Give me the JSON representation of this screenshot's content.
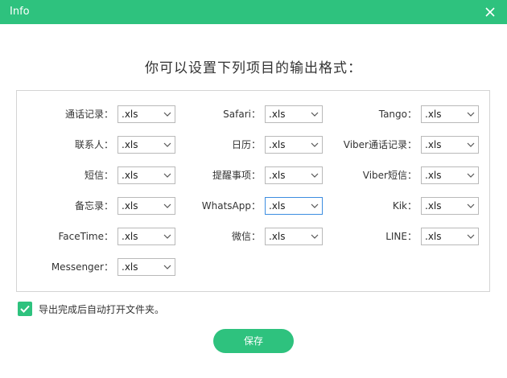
{
  "window": {
    "title": "Info",
    "accent_color": "#2ec27e",
    "close_icon": "close-icon"
  },
  "heading": "你可以设置下列项目的输出格式：",
  "formats": {
    "col1": [
      {
        "label": "通话记录：",
        "value": ".xls"
      },
      {
        "label": "联系人：",
        "value": ".xls"
      },
      {
        "label": "短信：",
        "value": ".xls"
      },
      {
        "label": "备忘录：",
        "value": ".xls"
      },
      {
        "label": "FaceTime：",
        "value": ".xls"
      },
      {
        "label": "Messenger：",
        "value": ".xls"
      }
    ],
    "col2": [
      {
        "label": "Safari：",
        "value": ".xls"
      },
      {
        "label": "日历：",
        "value": ".xls"
      },
      {
        "label": "提醒事项：",
        "value": ".xls"
      },
      {
        "label": "WhatsApp：",
        "value": ".xls"
      },
      {
        "label": "微信：",
        "value": ".xls"
      }
    ],
    "col3": [
      {
        "label": "Tango：",
        "value": ".xls"
      },
      {
        "label": "Viber通话记录：",
        "value": ".xls"
      },
      {
        "label": "Viber短信：",
        "value": ".xls"
      },
      {
        "label": "Kik：",
        "value": ".xls"
      },
      {
        "label": "LINE：",
        "value": ".xls"
      }
    ]
  },
  "auto_open": {
    "checked": true,
    "label": "导出完成后自动打开文件夹。"
  },
  "save_label": "保存"
}
